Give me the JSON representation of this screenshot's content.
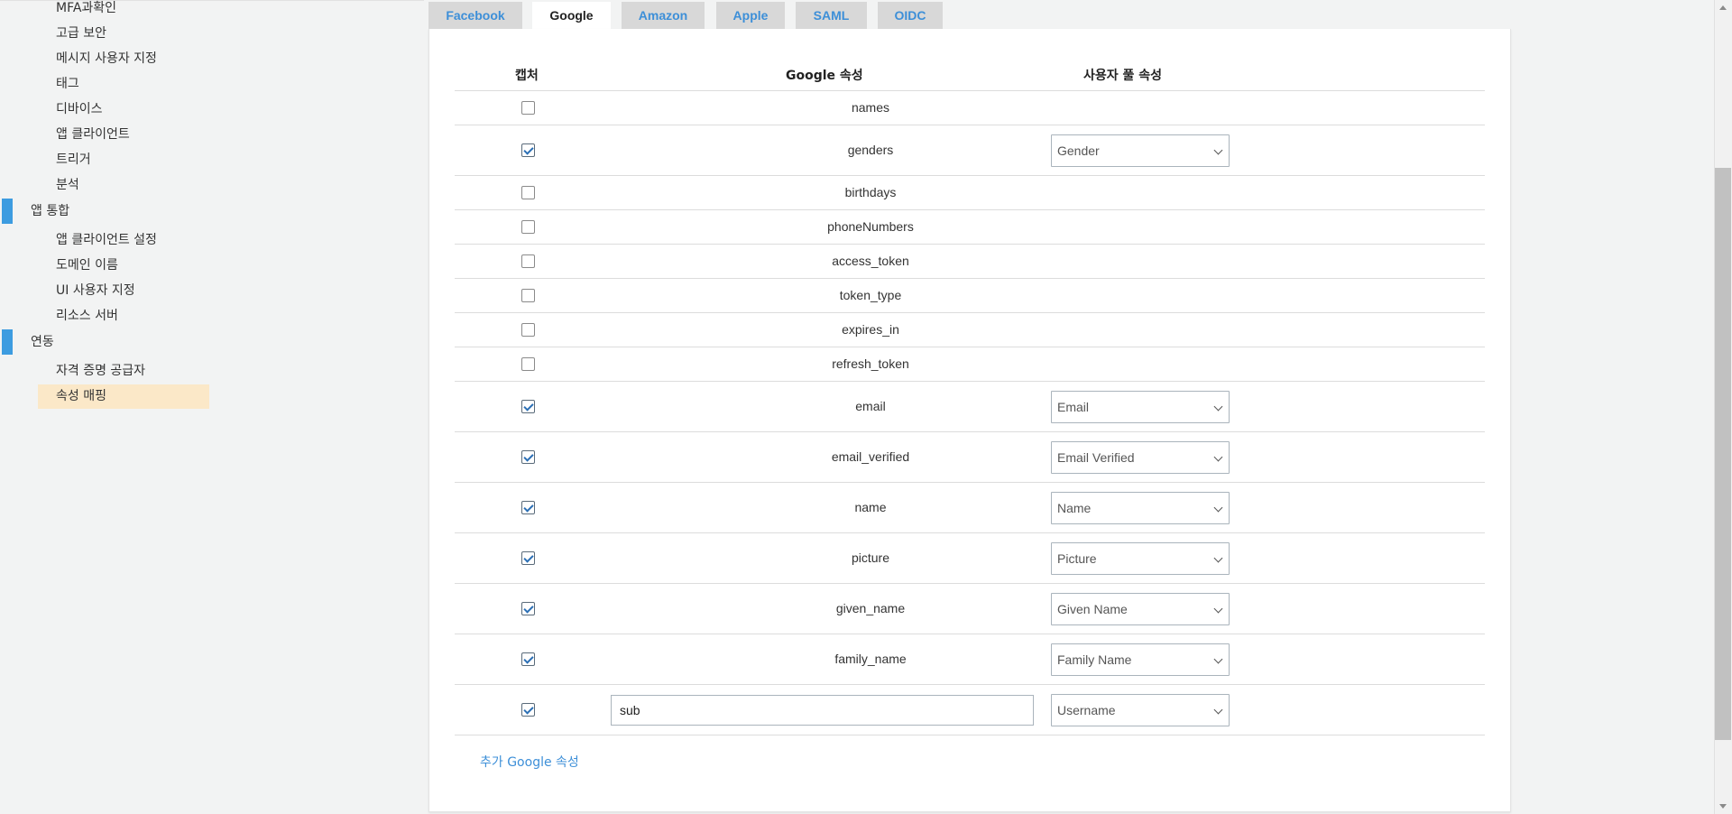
{
  "sidebar": {
    "items_top": [
      {
        "label": "MFA과확인"
      },
      {
        "label": "고급 보안"
      },
      {
        "label": "메시지 사용자 지정"
      },
      {
        "label": "태그"
      },
      {
        "label": "디바이스"
      },
      {
        "label": "앱 클라이언트"
      },
      {
        "label": "트리거"
      },
      {
        "label": "분석"
      }
    ],
    "section_app": {
      "label": "앱 통합"
    },
    "items_app": [
      {
        "label": "앱 클라이언트 설정"
      },
      {
        "label": "도메인 이름"
      },
      {
        "label": "UI 사용자 지정"
      },
      {
        "label": "리소스 서버"
      }
    ],
    "section_fed": {
      "label": "연동"
    },
    "items_fed": [
      {
        "label": "자격 증명 공급자"
      },
      {
        "label": "속성 매핑"
      }
    ],
    "accent_color": "#3d9ce0",
    "active_bg": "#fbe8c8"
  },
  "tabs": [
    {
      "label": "Facebook"
    },
    {
      "label": "Google"
    },
    {
      "label": "Amazon"
    },
    {
      "label": "Apple"
    },
    {
      "label": "SAML"
    },
    {
      "label": "OIDC"
    }
  ],
  "active_tab": "Google",
  "table": {
    "headers": {
      "capture": "캡처",
      "attribute": "Google 속성",
      "user_pool": "사용자 풀 속성"
    },
    "rows": [
      {
        "attribute": "names",
        "checked": false,
        "mapped": null
      },
      {
        "attribute": "genders",
        "checked": true,
        "mapped": "Gender"
      },
      {
        "attribute": "birthdays",
        "checked": false,
        "mapped": null
      },
      {
        "attribute": "phoneNumbers",
        "checked": false,
        "mapped": null
      },
      {
        "attribute": "access_token",
        "checked": false,
        "mapped": null
      },
      {
        "attribute": "token_type",
        "checked": false,
        "mapped": null
      },
      {
        "attribute": "expires_in",
        "checked": false,
        "mapped": null
      },
      {
        "attribute": "refresh_token",
        "checked": false,
        "mapped": null
      },
      {
        "attribute": "email",
        "checked": true,
        "mapped": "Email"
      },
      {
        "attribute": "email_verified",
        "checked": true,
        "mapped": "Email Verified"
      },
      {
        "attribute": "name",
        "checked": true,
        "mapped": "Name"
      },
      {
        "attribute": "picture",
        "checked": true,
        "mapped": "Picture"
      },
      {
        "attribute": "given_name",
        "checked": true,
        "mapped": "Given Name"
      },
      {
        "attribute": "family_name",
        "checked": true,
        "mapped": "Family Name"
      }
    ],
    "custom_row": {
      "value": "sub",
      "checked": true,
      "mapped": "Username"
    }
  },
  "add_link": "추가 Google 속성",
  "link_color": "#3d8fd8",
  "icons": {
    "checkbox": "checkmark-icon",
    "select": "chevron-down-icon"
  }
}
